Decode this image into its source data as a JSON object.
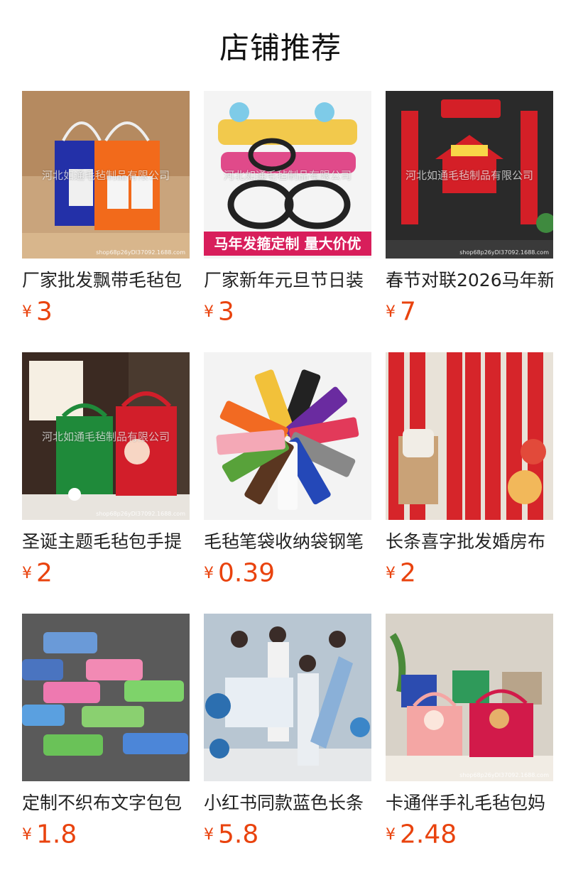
{
  "page": {
    "title": "店铺推荐"
  },
  "watermark": "河北如通毛毡制品有限公司",
  "shop_tag": "shop68p26yDl37092.1688.com",
  "products": [
    {
      "name": "厂家批发飘带毛毡包",
      "currency": "¥",
      "price": "3",
      "image": "felt-tote-bags"
    },
    {
      "name": "厂家新年元旦节日装",
      "currency": "¥",
      "price": "3",
      "image": "new-year-headbands",
      "banner": "马年发箍定制 量大价优"
    },
    {
      "name": "春节对联2026马年新",
      "currency": "¥",
      "price": "7",
      "image": "spring-couplets"
    },
    {
      "name": "圣诞主题毛毡包手提",
      "currency": "¥",
      "price": "2",
      "image": "christmas-felt-bags"
    },
    {
      "name": "毛毡笔袋收纳袋钢笔",
      "currency": "¥",
      "price": "0.39",
      "image": "felt-pen-sleeves"
    },
    {
      "name": "长条喜字批发婚房布",
      "currency": "¥",
      "price": "2",
      "image": "double-happiness-banner"
    },
    {
      "name": "定制不织布文字包包",
      "currency": "¥",
      "price": "1.8",
      "image": "custom-text-tags"
    },
    {
      "name": "小红书同款蓝色长条",
      "currency": "¥",
      "price": "5.8",
      "image": "blue-wedding-banner"
    },
    {
      "name": "卡通伴手礼毛毡包妈",
      "currency": "¥",
      "price": "2.48",
      "image": "cartoon-gift-bags"
    }
  ],
  "colors": {
    "price": "#e9430e",
    "title": "#111111"
  }
}
